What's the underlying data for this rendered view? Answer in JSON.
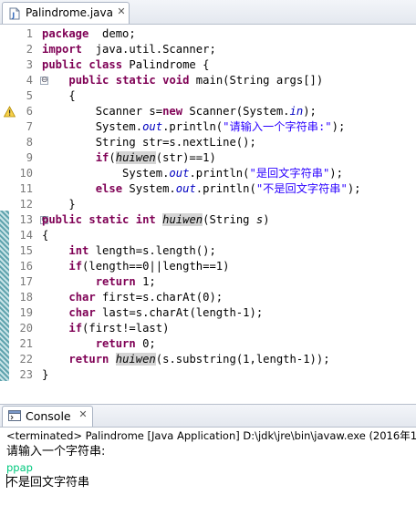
{
  "editor_tab": {
    "label": "Palindrome.java",
    "close": "✕",
    "icon": "java-file-icon"
  },
  "gutter": {
    "line_numbers": [
      "1",
      "2",
      "3",
      "4",
      "5",
      "6",
      "7",
      "8",
      "9",
      "10",
      "11",
      "12",
      "13",
      "14",
      "15",
      "16",
      "17",
      "18",
      "19",
      "20",
      "21",
      "22",
      "23"
    ],
    "markers": [
      {
        "line": 4,
        "type": "fold-collapse",
        "glyph": "⊖"
      },
      {
        "line": 6,
        "type": "warning-icon"
      },
      {
        "line": 13,
        "type": "fold-collapse",
        "glyph": "⊖"
      }
    ]
  },
  "code_lines": [
    [
      [
        "kw",
        "package"
      ],
      [
        "",
        "  demo;"
      ]
    ],
    [
      [
        "kw",
        "import"
      ],
      [
        "",
        "  java.util.Scanner;"
      ]
    ],
    [
      [
        "kw",
        "public"
      ],
      [
        "",
        " "
      ],
      [
        "kw",
        "class"
      ],
      [
        "",
        " Palindrome {"
      ]
    ],
    [
      [
        "",
        "    "
      ],
      [
        "kw",
        "public"
      ],
      [
        "",
        " "
      ],
      [
        "kw",
        "static"
      ],
      [
        "",
        " "
      ],
      [
        "kw",
        "void"
      ],
      [
        "",
        " main(String args[])"
      ]
    ],
    [
      [
        "",
        "    {"
      ]
    ],
    [
      [
        "",
        "        Scanner s="
      ],
      [
        "kw",
        "new"
      ],
      [
        "",
        " Scanner(System."
      ],
      [
        "fld",
        "in"
      ],
      [
        "",
        ");"
      ]
    ],
    [
      [
        "",
        "        System."
      ],
      [
        "fld",
        "out"
      ],
      [
        "",
        ".println("
      ],
      [
        "str",
        "\"请输入一个字符串:\""
      ],
      [
        "",
        ");"
      ]
    ],
    [
      [
        "",
        "        String str=s.nextLine();"
      ]
    ],
    [
      [
        "",
        "        "
      ],
      [
        "kw",
        "if"
      ],
      [
        "",
        "("
      ],
      [
        "sfn",
        "huiwen"
      ],
      [
        "",
        "(str)==1)"
      ]
    ],
    [
      [
        "",
        "            System."
      ],
      [
        "fld",
        "out"
      ],
      [
        "",
        ".println("
      ],
      [
        "str",
        "\"是回文字符串\""
      ],
      [
        "",
        ");"
      ]
    ],
    [
      [
        "",
        "        "
      ],
      [
        "kw",
        "else"
      ],
      [
        "",
        " System."
      ],
      [
        "fld",
        "out"
      ],
      [
        "",
        ".println("
      ],
      [
        "str",
        "\"不是回文字符串\""
      ],
      [
        "",
        ");"
      ]
    ],
    [
      [
        "",
        "    }"
      ]
    ],
    [
      [
        "kw",
        "public"
      ],
      [
        "",
        " "
      ],
      [
        "kw",
        "static"
      ],
      [
        "",
        " "
      ],
      [
        "kw",
        "int"
      ],
      [
        "",
        " "
      ],
      [
        "sfn",
        "huiwen"
      ],
      [
        "",
        "(String "
      ],
      [
        "ital",
        "s"
      ],
      [
        "",
        ")"
      ]
    ],
    [
      [
        "",
        "{"
      ]
    ],
    [
      [
        "",
        "    "
      ],
      [
        "kw",
        "int"
      ],
      [
        "",
        " length=s.length();"
      ]
    ],
    [
      [
        "",
        "    "
      ],
      [
        "kw",
        "if"
      ],
      [
        "",
        "(length==0||length==1)"
      ]
    ],
    [
      [
        "",
        "        "
      ],
      [
        "kw",
        "return"
      ],
      [
        "",
        " 1;"
      ]
    ],
    [
      [
        "",
        "    "
      ],
      [
        "kw",
        "char"
      ],
      [
        "",
        " first=s.charAt(0);"
      ]
    ],
    [
      [
        "",
        "    "
      ],
      [
        "kw",
        "char"
      ],
      [
        "",
        " last=s.charAt(length-1);"
      ]
    ],
    [
      [
        "",
        "    "
      ],
      [
        "kw",
        "if"
      ],
      [
        "",
        "(first!=last)"
      ]
    ],
    [
      [
        "",
        "        "
      ],
      [
        "kw",
        "return"
      ],
      [
        "",
        " 0;"
      ]
    ],
    [
      [
        "",
        "    "
      ],
      [
        "kw",
        "return"
      ],
      [
        "",
        " "
      ],
      [
        "sfn",
        "huiwen"
      ],
      [
        "",
        "(s.substring(1,length-1));"
      ]
    ],
    [
      [
        "",
        "}"
      ]
    ]
  ],
  "console_tab": {
    "label": "Console",
    "close": "✕",
    "icon": "console-icon"
  },
  "console": {
    "status": "<terminated> Palindrome [Java Application] D:\\jdk\\jre\\bin\\javaw.exe (2016年1",
    "lines": [
      {
        "text": "请输入一个字符串:",
        "color": "#000000"
      },
      {
        "text": "ppap",
        "color": "#00c87d"
      },
      {
        "text": "不是回文字符串",
        "color": "#000000"
      }
    ]
  },
  "colors": {
    "keyword": "#7f0055",
    "string": "#2a00ff",
    "field": "#0000c0",
    "line_number": "#7a7a7a",
    "input_text": "#00c87d"
  }
}
